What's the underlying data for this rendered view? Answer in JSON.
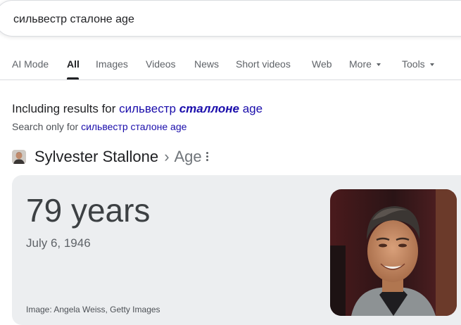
{
  "search": {
    "query": "сильвестр сталоне age"
  },
  "tabs": [
    {
      "label": "AI Mode"
    },
    {
      "label": "All"
    },
    {
      "label": "Images"
    },
    {
      "label": "Videos"
    },
    {
      "label": "News"
    },
    {
      "label": "Short videos"
    },
    {
      "label": "Web"
    },
    {
      "label": "More"
    },
    {
      "label": "Tools"
    }
  ],
  "spelling": {
    "including_prefix": "Including results for",
    "corrected_part1": "сильвестр",
    "corrected_bold": "сталлоне",
    "corrected_part2": "age",
    "search_only_prefix": "Search only for",
    "original_query": "сильвестр сталоне age"
  },
  "entity": {
    "name": "Sylvester Stallone",
    "separator": "›",
    "attribute": "Age"
  },
  "answer": {
    "value": "79 years",
    "birth_date": "July 6, 1946",
    "image_credit": "Image: Angela Weiss, Getty Images"
  },
  "icons": {
    "entity_thumb": "person-thumbnail-icon",
    "more_options": "more-vert-icon",
    "dropdown": "caret-down-icon"
  },
  "colors": {
    "link": "#1a0dab",
    "card_background": "#eceef0",
    "active_tab": "#202124",
    "muted_text": "#5f6368"
  }
}
